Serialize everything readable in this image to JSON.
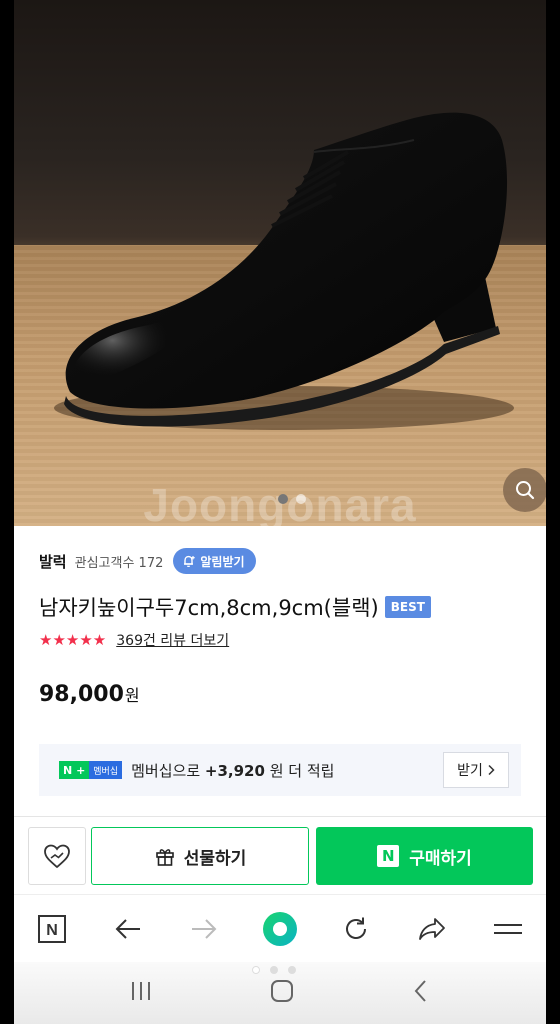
{
  "product_image": {
    "watermark": "Joongonara",
    "image_dots": 2,
    "active_dot": 0
  },
  "seller": {
    "name": "발럭",
    "interest_label": "관심고객수 172",
    "alarm_label": "알림받기"
  },
  "product": {
    "title": "남자키높이구두7cm,8cm,9cm(블랙)",
    "badge": "BEST",
    "stars": "★★★★★",
    "rating": 5,
    "review_link": "369건 리뷰 더보기",
    "price": "98,000",
    "currency": "원"
  },
  "membership": {
    "badge_n": "N",
    "badge_plus": "+",
    "badge_label": "멤버십",
    "text_prefix": "멤버십으로 ",
    "amount": "+3,920",
    "text_suffix": " 원 더 적립",
    "receive_label": "받기"
  },
  "buybar": {
    "gift_label": "선물하기",
    "buy_label": "구매하기",
    "n_logo": "N"
  },
  "browser_toolbar": {
    "icons": [
      "naver-n-icon",
      "back-arrow-icon",
      "forward-arrow-icon",
      "green-dot-home-icon",
      "refresh-icon",
      "share-icon",
      "menu-icon"
    ],
    "naver_label": "N"
  },
  "colors": {
    "naver_green": "#03c75a",
    "accent_blue": "#5a8be2",
    "star_red": "#f2304c"
  }
}
